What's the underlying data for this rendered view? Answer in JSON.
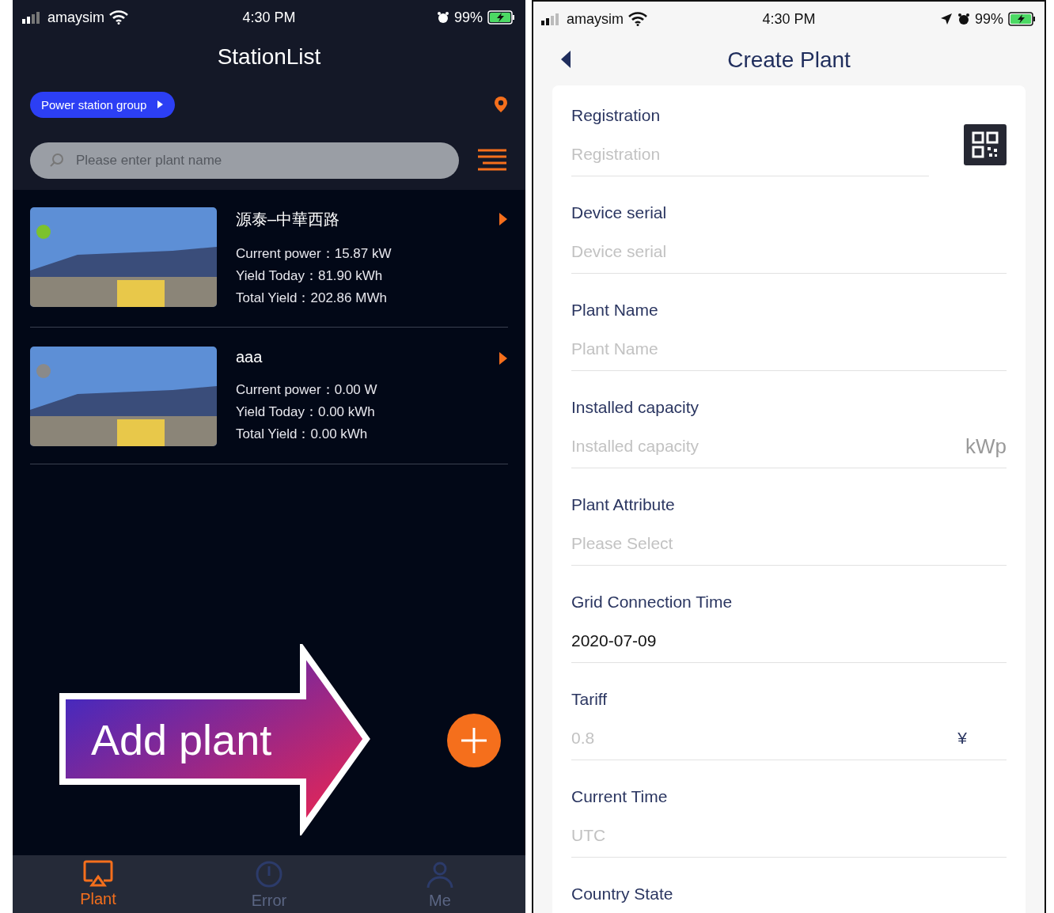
{
  "station_list": {
    "status_bar": {
      "carrier": "amaysim",
      "time": "4:30 PM",
      "battery": "99%"
    },
    "title": "StationList",
    "group_button": "Power station group",
    "search": {
      "placeholder": "Please enter plant name"
    },
    "stations": [
      {
        "name": "源泰–中華西路",
        "color": "#7cc22e",
        "metrics": [
          {
            "label": "Current power：",
            "value": "15.87 kW"
          },
          {
            "label": "Yield Today：",
            "value": "81.90 kWh"
          },
          {
            "label": "Total Yield：",
            "value": "202.86 MWh"
          }
        ]
      },
      {
        "name": "aaa",
        "color": "#8a8a8a",
        "metrics": [
          {
            "label": "Current power：",
            "value": "0.00 W"
          },
          {
            "label": "Yield Today：",
            "value": "0.00 kWh"
          },
          {
            "label": "Total Yield：",
            "value": "0.00 kWh"
          }
        ]
      }
    ],
    "callout": "Add plant",
    "tabs": [
      {
        "label": "Plant",
        "kind": "plant",
        "selected": true
      },
      {
        "label": "Error",
        "kind": "error",
        "selected": false
      },
      {
        "label": "Me",
        "kind": "me",
        "selected": false
      }
    ]
  },
  "create_plant": {
    "status_bar": {
      "carrier": "amaysim",
      "time": "4:30 PM",
      "battery": "99%"
    },
    "title": "Create Plant",
    "fields": [
      {
        "label": "Registration",
        "placeholder": "Registration",
        "kind": "qr"
      },
      {
        "label": "Device serial",
        "placeholder": "Device serial",
        "kind": "text"
      },
      {
        "label": "Plant Name",
        "placeholder": "Plant Name",
        "kind": "text"
      },
      {
        "label": "Installed capacity",
        "placeholder": "Installed capacity",
        "unit": "kWp",
        "kind": "unit"
      },
      {
        "label": "Plant Attribute",
        "placeholder": "Please Select",
        "kind": "text"
      },
      {
        "label": "Grid Connection Time",
        "value": "2020-07-09",
        "kind": "text"
      },
      {
        "label": "Tariff",
        "placeholder": "0.8",
        "unit": "¥",
        "kind": "currency"
      },
      {
        "label": "Current Time",
        "placeholder": "UTC",
        "kind": "text"
      },
      {
        "label": "Country State"
      }
    ]
  }
}
